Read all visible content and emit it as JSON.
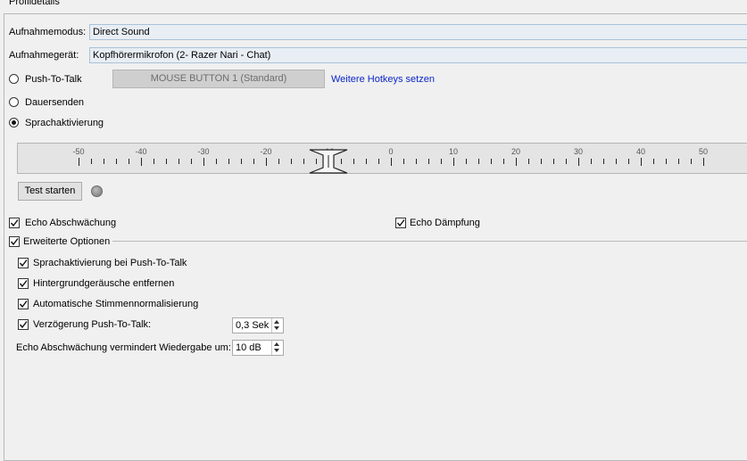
{
  "group_title": "Profildetails",
  "recording_mode": {
    "label": "Aufnahmemodus:",
    "value": "Direct Sound"
  },
  "recording_device": {
    "label": "Aufnahmegerät:",
    "value": "Kopfhörermikrofon (2- Razer Nari - Chat)"
  },
  "push_to_talk": {
    "label": "Push-To-Talk",
    "selected": false,
    "hotkey": "MOUSE BUTTON 1 (Standard)",
    "more_hotkeys": "Weitere Hotkeys setzen"
  },
  "continuous": {
    "label": "Dauersenden",
    "selected": false
  },
  "voice_activation": {
    "label": "Sprachaktivierung",
    "selected": true,
    "scale_labels": [
      "-50",
      "-40",
      "-30",
      "-20",
      "-10",
      "0",
      "10",
      "20",
      "30",
      "40",
      "50"
    ],
    "threshold": -10
  },
  "test_button": "Test starten",
  "echo_reduction": {
    "label": "Echo Abschwächung",
    "checked": true
  },
  "echo_cancellation": {
    "label": "Echo Dämpfung",
    "checked": true
  },
  "advanced_options": {
    "label": "Erweiterte Optionen",
    "checked": true
  },
  "options": {
    "vad_ptt": {
      "label": "Sprachaktivierung bei Push-To-Talk",
      "checked": true
    },
    "noise_removal": {
      "label": "Hintergrundgeräusche entfernen",
      "checked": true
    },
    "auto_normalization": {
      "label": "Automatische Stimmennormalisierung",
      "checked": true
    },
    "ptt_delay": {
      "label": "Verzögerung Push-To-Talk:",
      "checked": true,
      "value": "0,3 Sek"
    },
    "echo_reduce_playback": {
      "label": "Echo Abschwächung vermindert Wiedergabe um:",
      "value": "10 dB"
    }
  },
  "colors": {
    "link": "#0b26c8",
    "combo_border": "#a9c2d9"
  }
}
